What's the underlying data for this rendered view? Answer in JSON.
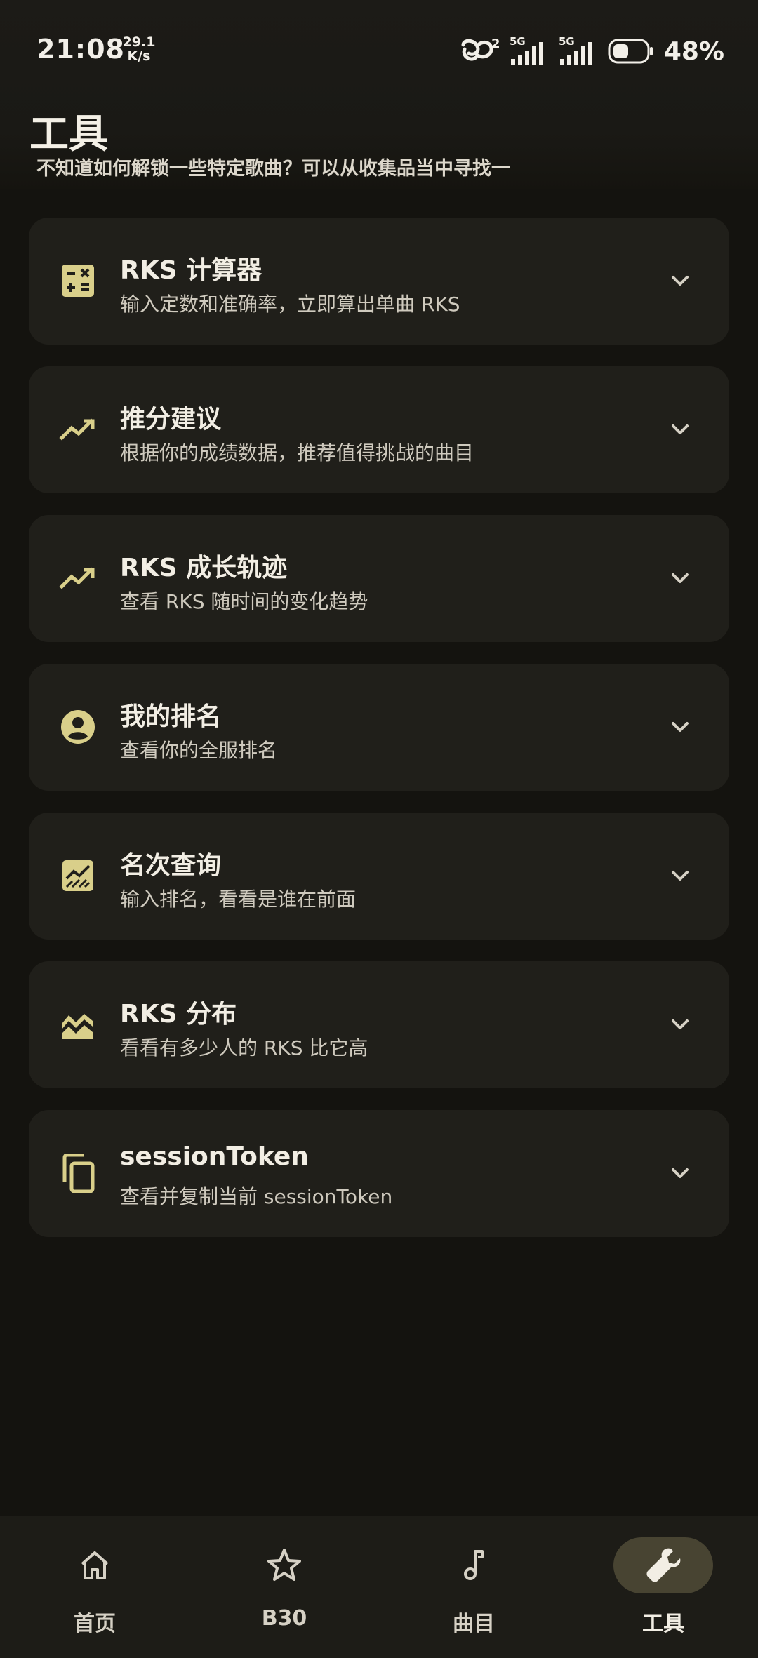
{
  "status_bar": {
    "time": "21:08",
    "net_speed_value": "29.1",
    "net_speed_unit": "K/s",
    "hd_suffix": "2",
    "network_1": "5G",
    "network_2": "5G",
    "battery_level": 0.48,
    "battery_text": "48%"
  },
  "header": {
    "title": "工具",
    "subtitle": "不知道如何解锁一些特定歌曲？可以从收集品当中寻找一"
  },
  "tools": [
    {
      "icon": "calculator-icon",
      "title": "RKS 计算器",
      "description": "输入定数和准确率，立即算出单曲 RKS"
    },
    {
      "icon": "trending-up-icon",
      "title": "推分建议",
      "description": "根据你的成绩数据，推荐值得挑战的曲目"
    },
    {
      "icon": "trending-up-icon",
      "title": "RKS 成长轨迹",
      "description": "查看 RKS 随时间的变化趋势"
    },
    {
      "icon": "account-circle-icon",
      "title": "我的排名",
      "description": "查看你的全服排名"
    },
    {
      "icon": "chart-box-icon",
      "title": "名次查询",
      "description": "输入排名，看看是谁在前面"
    },
    {
      "icon": "area-chart-icon",
      "title": "RKS 分布",
      "description": "看看有多少人的 RKS 比它高"
    },
    {
      "icon": "copy-icon",
      "title": "sessionToken",
      "description": "查看并复制当前 sessionToken"
    }
  ],
  "bottom_nav": {
    "items": [
      {
        "icon": "home-icon",
        "label": "首页",
        "active": false
      },
      {
        "icon": "star-icon",
        "label": "B30",
        "active": false
      },
      {
        "icon": "music-note-icon",
        "label": "曲目",
        "active": false
      },
      {
        "icon": "wrench-icon",
        "label": "工具",
        "active": true
      }
    ]
  },
  "colors": {
    "background": "#14130f",
    "card": "#201f1a",
    "accent_icon": "#d9cf8a",
    "active_pill": "#484432"
  }
}
